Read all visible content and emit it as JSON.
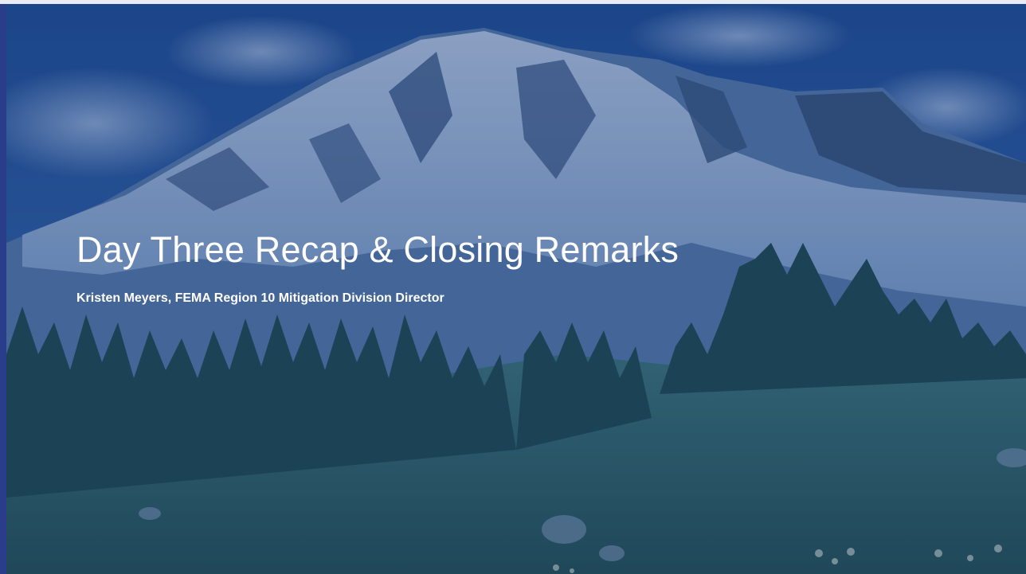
{
  "slide": {
    "title": "Day Three Recap & Closing Remarks",
    "subtitle": "Kristen Meyers, FEMA Region 10 Mitigation Division Director"
  },
  "colors": {
    "frame_blue": "#2a3d8a",
    "overlay_blue": "#163478",
    "text": "#ffffff"
  }
}
